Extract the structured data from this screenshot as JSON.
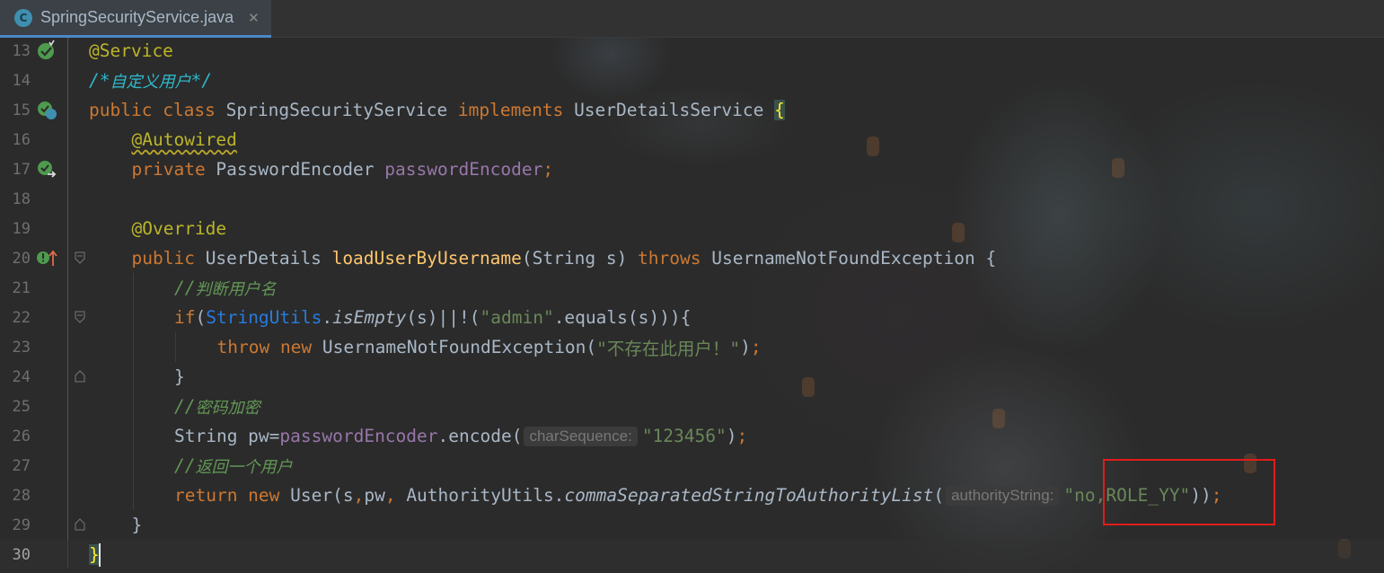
{
  "tab": {
    "icon_letter": "C",
    "filename": "SpringSecurityService.java",
    "close": "✕"
  },
  "lines": [
    {
      "num": "13",
      "parts": [
        "@Service"
      ]
    },
    {
      "num": "14",
      "parts": [
        "/*",
        "自定义用户",
        "*/"
      ]
    },
    {
      "num": "15",
      "parts": [
        "public",
        " class ",
        "SpringSecurityService ",
        "implements",
        " UserDetailsService ",
        "{"
      ]
    },
    {
      "num": "16",
      "parts": [
        "@Autowired"
      ]
    },
    {
      "num": "17",
      "parts": [
        "private",
        " PasswordEncoder ",
        "passwordEncoder",
        ";"
      ]
    },
    {
      "num": "18",
      "parts": []
    },
    {
      "num": "19",
      "parts": [
        "@Override"
      ]
    },
    {
      "num": "20",
      "parts": [
        "public",
        " UserDetails ",
        "loadUserByUsername",
        "(String s) ",
        "throws",
        " UsernameNotFoundException {"
      ]
    },
    {
      "num": "21",
      "parts": [
        "//",
        "判断用户名"
      ]
    },
    {
      "num": "22",
      "parts": [
        "if",
        "(",
        "StringUtils",
        ".",
        "isEmpty",
        "(s)||!(",
        "\"admin\"",
        ".equals(s))){"
      ]
    },
    {
      "num": "23",
      "parts": [
        "throw new",
        " UsernameNotFoundException(",
        "\"不存在此用户！\"",
        ")",
        ";"
      ]
    },
    {
      "num": "24",
      "parts": [
        "}"
      ]
    },
    {
      "num": "25",
      "parts": [
        "//",
        "密码加密"
      ]
    },
    {
      "num": "26",
      "parts": [
        "String pw=",
        "passwordEncoder",
        ".encode(",
        "charSequence:",
        "\"123456\"",
        ")",
        ";"
      ]
    },
    {
      "num": "27",
      "parts": [
        "//",
        "返回一个用户"
      ]
    },
    {
      "num": "28",
      "parts": [
        "return new",
        " User(s",
        ",",
        "pw",
        ",",
        " AuthorityUtils.",
        "commaSeparatedStringToAuthorityList",
        "(",
        "authorityString:",
        "\"no,ROLE_YY\"",
        "))",
        ";"
      ]
    },
    {
      "num": "29",
      "parts": [
        "}"
      ]
    },
    {
      "num": "30",
      "parts": [
        "}"
      ]
    }
  ],
  "colors": {
    "keyword": "#cc7832",
    "annotation": "#bbb529",
    "field": "#9876aa",
    "string": "#6a8759",
    "comment": "#629755",
    "method_decl": "#ffc66d",
    "highlight_box": "#e21c1c"
  },
  "icons": {
    "line13": "spring-bean-icon",
    "line15": "spring-bean-class-icon",
    "line17": "autowired-navigate-icon",
    "line20": "override-method-icon"
  }
}
